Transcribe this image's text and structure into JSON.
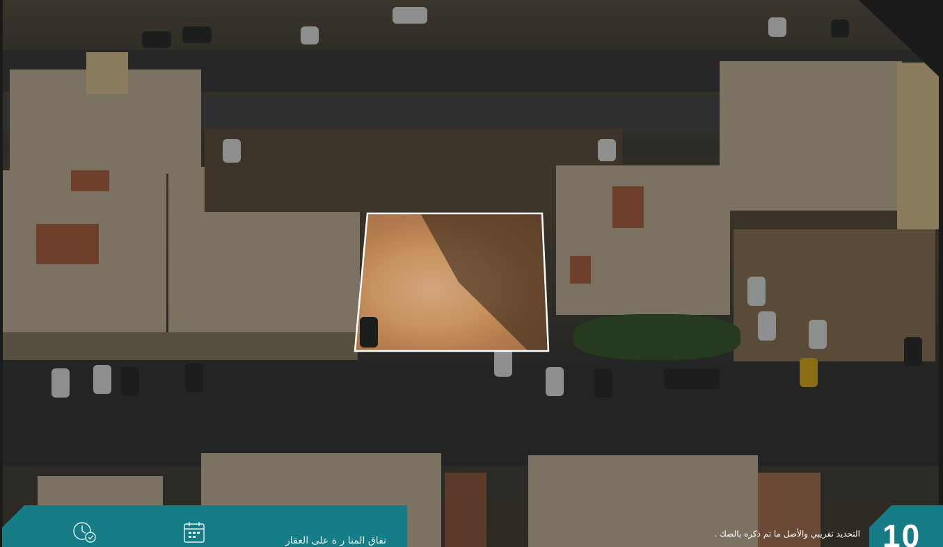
{
  "page": {
    "number": "10",
    "disclaimer": "التحديد تقريبي والأصل ما تم ذكره بالصك ."
  },
  "info_panel": {
    "text": "تفاق المنا ر ة على العقار",
    "icons": [
      "clock-check-icon",
      "calendar-icon"
    ]
  },
  "colors": {
    "panel": "#167c86",
    "outline": "#ffffff",
    "text": "#ffffff"
  }
}
